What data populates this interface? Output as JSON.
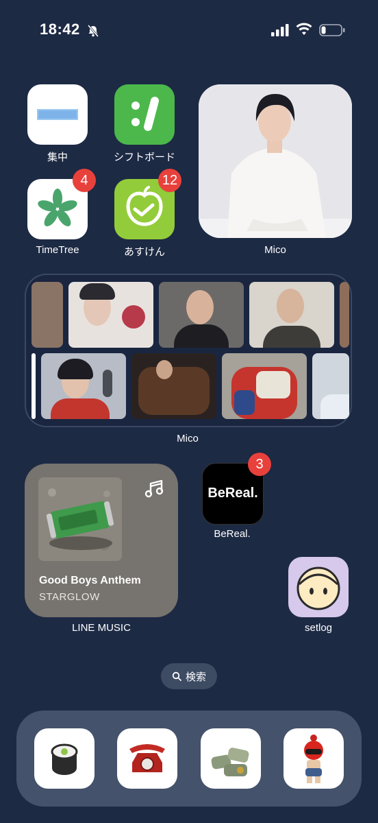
{
  "status": {
    "time": "18:42"
  },
  "apps": {
    "shuchu": {
      "label": "集中"
    },
    "shiftboard": {
      "label": "シフトボード"
    },
    "timetree": {
      "label": "TimeTree",
      "badge": "4"
    },
    "asuken": {
      "label": "あすけん",
      "badge": "12"
    },
    "bereal": {
      "label": "BeReal.",
      "badge": "3",
      "icon_text": "BeReal."
    },
    "setlog": {
      "label": "setlog"
    }
  },
  "widgets": {
    "photo": {
      "label": "Mico"
    },
    "strip": {
      "label": "Mico"
    },
    "music": {
      "label": "LINE MUSIC",
      "song": "Good Boys Anthem",
      "artist": "STARGLOW",
      "album_text": "Good Boys Anthem"
    }
  },
  "search": {
    "label": "検索"
  },
  "dock": {
    "items": [
      "sushi-roll-icon",
      "red-phone-icon",
      "money-stack-icon",
      "figure-icon"
    ]
  },
  "colors": {
    "background": "#1d2a44",
    "badge": "#e8413c",
    "shiftboard": "#4cb84b",
    "asuken": "#93cc3a"
  }
}
